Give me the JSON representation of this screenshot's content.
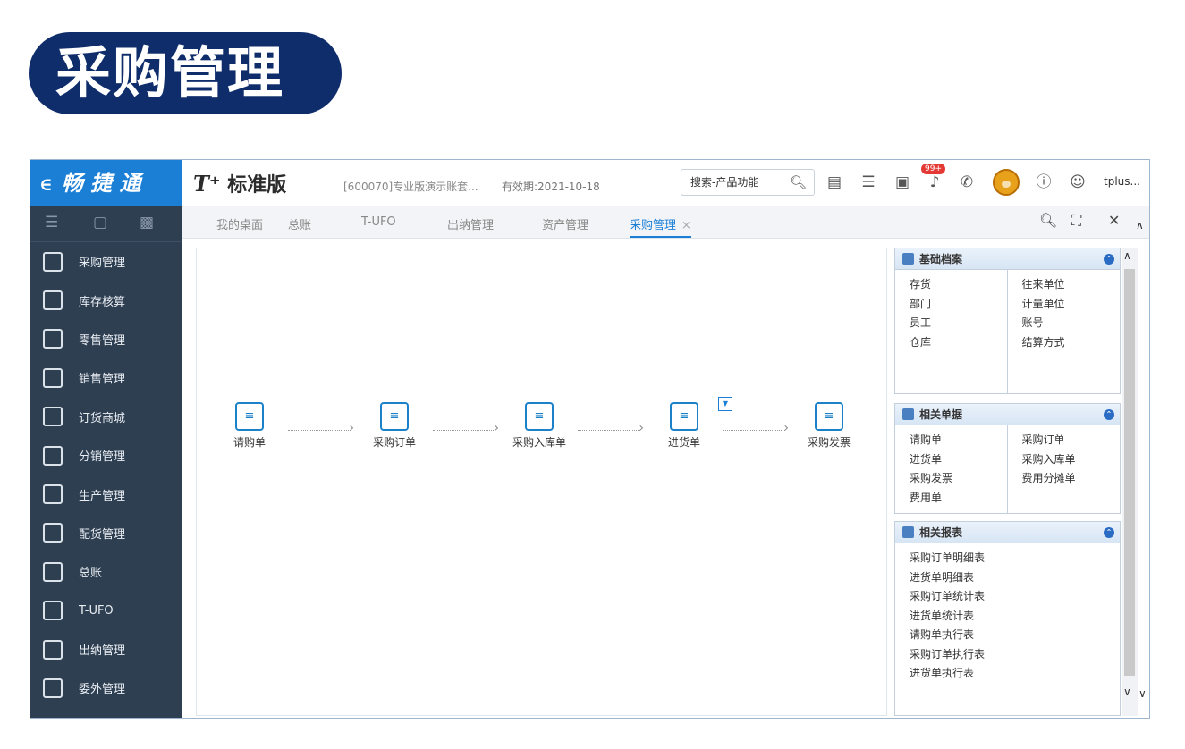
{
  "page_heading": "采购管理",
  "brand": {
    "arrow": "∈",
    "name": "畅 捷 通"
  },
  "topbar": {
    "product_prefix": "T⁺",
    "product_name": "标准版",
    "account": "[600070]专业版演示账套...",
    "validity": "有效期:2021-10-18",
    "search_placeholder": "搜索-产品功能",
    "badge_count": "99+",
    "user": "tplus..."
  },
  "sidebar": {
    "items": [
      {
        "label": "采购管理",
        "icon": "cart-icon"
      },
      {
        "label": "库存核算",
        "icon": "inventory-icon"
      },
      {
        "label": "零售管理",
        "icon": "retail-icon"
      },
      {
        "label": "销售管理",
        "icon": "sales-chart-icon"
      },
      {
        "label": "订货商城",
        "icon": "mall-icon"
      },
      {
        "label": "分销管理",
        "icon": "distribution-icon"
      },
      {
        "label": "生产管理",
        "icon": "production-icon"
      },
      {
        "label": "配货管理",
        "icon": "delivery-icon"
      },
      {
        "label": "总账",
        "icon": "ledger-icon"
      },
      {
        "label": "T-UFO",
        "icon": "ufo-icon"
      },
      {
        "label": "出纳管理",
        "icon": "cashier-icon"
      },
      {
        "label": "委外管理",
        "icon": "outsource-icon"
      }
    ]
  },
  "tabs": [
    {
      "label": "我的桌面"
    },
    {
      "label": "总账"
    },
    {
      "label": "T-UFO"
    },
    {
      "label": "出纳管理"
    },
    {
      "label": "资产管理"
    },
    {
      "label": "采购管理",
      "close": "×",
      "active": true
    }
  ],
  "flow": [
    {
      "label": "请购单",
      "icon": "requisition-icon"
    },
    {
      "label": "采购订单",
      "icon": "purchase-order-icon"
    },
    {
      "label": "采购入库单",
      "icon": "warehouse-in-icon"
    },
    {
      "label": "进货单",
      "icon": "receipt-icon"
    },
    {
      "label": "采购发票",
      "icon": "invoice-icon"
    }
  ],
  "panels": {
    "basic": {
      "title": "基础档案",
      "left": [
        "存货",
        "部门",
        "员工",
        "仓库"
      ],
      "right": [
        "往来单位",
        "计量单位",
        "账号",
        "结算方式"
      ]
    },
    "docs": {
      "title": "相关单据",
      "left": [
        "请购单",
        "进货单",
        "采购发票",
        "费用单"
      ],
      "right": [
        "采购订单",
        "采购入库单",
        "费用分摊单"
      ]
    },
    "reports": {
      "title": "相关报表",
      "items": [
        "采购订单明细表",
        "进货单明细表",
        "采购订单统计表",
        "进货单统计表",
        "请购单执行表",
        "采购订单执行表",
        "进货单执行表"
      ]
    }
  },
  "colors": {
    "brand_blue": "#1b7fd6",
    "sidebar_bg": "#2f3f52",
    "title_bg": "#0f2d6b",
    "badge_red": "#e53935"
  }
}
